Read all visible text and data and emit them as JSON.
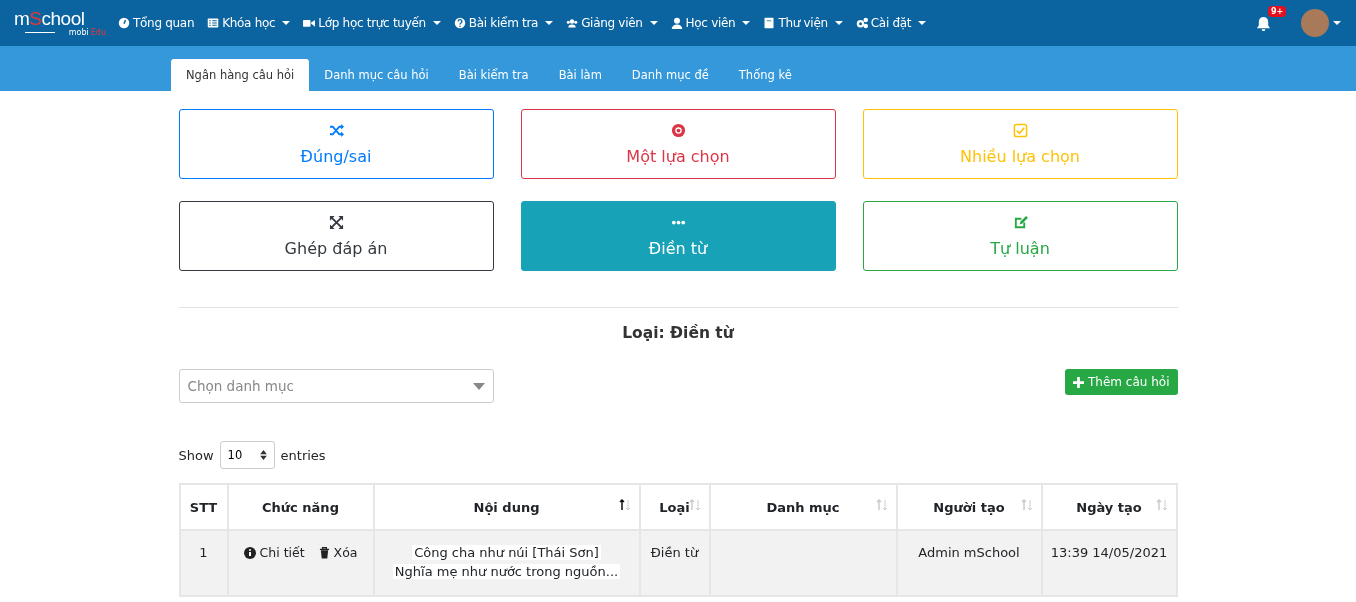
{
  "logo": {
    "title": [
      {
        "text": "m",
        "accent": false
      },
      {
        "text": "S",
        "accent": true
      },
      {
        "text": "chool",
        "accent": false
      }
    ],
    "subtitle": [
      {
        "text": "mobi",
        "accent": false
      },
      {
        "text": "Edu",
        "accent": true
      }
    ]
  },
  "nav": [
    {
      "label": "Tổng quan",
      "kind": "gauge",
      "dropdown": false
    },
    {
      "label": "Khóa học",
      "kind": "list",
      "dropdown": true
    },
    {
      "label": "Lớp học trực tuyến",
      "kind": "video",
      "dropdown": true
    },
    {
      "label": "Bài kiểm tra",
      "kind": "question",
      "dropdown": true
    },
    {
      "label": "Giảng viên",
      "kind": "users",
      "dropdown": true
    },
    {
      "label": "Học viên",
      "kind": "user",
      "dropdown": true
    },
    {
      "label": "Thư viện",
      "kind": "book",
      "dropdown": true
    },
    {
      "label": "Cài đặt",
      "kind": "gears",
      "dropdown": true
    }
  ],
  "notifications": {
    "badge": "9+"
  },
  "tabs": [
    {
      "label": "Ngân hàng câu hỏi",
      "selected": true
    },
    {
      "label": "Danh mục câu hỏi",
      "selected": false
    },
    {
      "label": "Bài kiểm tra",
      "selected": false
    },
    {
      "label": "Bài làm",
      "selected": false
    },
    {
      "label": "Danh mục đề",
      "selected": false
    },
    {
      "label": "Thống kê",
      "selected": false
    }
  ],
  "question_types": [
    {
      "label": "Đúng/sai",
      "kind": "shuffle",
      "color": "#007bff",
      "selected": false
    },
    {
      "label": "Một lựa chọn",
      "kind": "radio",
      "color": "#dc3545",
      "selected": false
    },
    {
      "label": "Nhiều lựa chọn",
      "kind": "checkbox",
      "color": "#ffc107",
      "selected": false
    },
    {
      "label": "Ghép đáp án",
      "kind": "arrows",
      "color": "#343a40",
      "selected": false
    },
    {
      "label": "Điền từ",
      "kind": "dots",
      "color": "#17a2b8",
      "selected": true
    },
    {
      "label": "Tự luận",
      "kind": "edit",
      "color": "#28a745",
      "selected": false
    }
  ],
  "heading": "Loại: Điền từ",
  "category_select": {
    "placeholder": "Chọn danh mục"
  },
  "add_button": "Thêm câu hỏi",
  "length": {
    "before": "Show",
    "value": "10",
    "after": "entries"
  },
  "table": {
    "columns": [
      {
        "label": "STT",
        "sortable": false
      },
      {
        "label": "Chức năng",
        "sortable": false
      },
      {
        "label": "Nội dung",
        "sortable": true,
        "sorted": true
      },
      {
        "label": "Loại",
        "sortable": true,
        "sorted": false
      },
      {
        "label": "Danh mục",
        "sortable": true,
        "sorted": false
      },
      {
        "label": "Người tạo",
        "sortable": true,
        "sorted": false
      },
      {
        "label": "Ngày tạo",
        "sortable": true,
        "sorted": false
      }
    ],
    "rows": [
      {
        "stt": "1",
        "actions": [
          {
            "label": "Chi tiết",
            "kind": "info"
          },
          {
            "label": "Xóa",
            "kind": "trash"
          }
        ],
        "content": [
          "Công cha như núi [Thái Sơn]",
          "Nghĩa mẹ như nước trong nguồn..."
        ],
        "type": "Điền từ",
        "creator": "Admin mSchool",
        "created": "13:39 14/05/2021"
      }
    ]
  }
}
